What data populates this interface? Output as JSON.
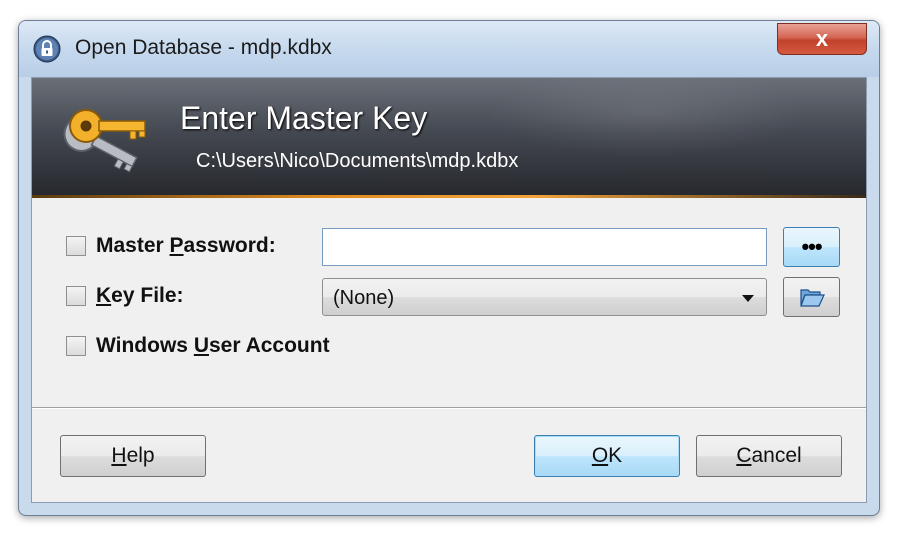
{
  "window": {
    "title": "Open Database - mdp.kdbx",
    "close_label": "x"
  },
  "banner": {
    "title": "Enter Master Key",
    "path": "C:\\Users\\Nico\\Documents\\mdp.kdbx"
  },
  "options": {
    "master_password": {
      "label_pre": "Master ",
      "label_access": "P",
      "label_post": "assword:",
      "checked": false,
      "value": "",
      "show_button": "•••"
    },
    "key_file": {
      "label_pre": "",
      "label_access": "K",
      "label_post": "ey File:",
      "checked": false,
      "selected": "(None)"
    },
    "windows_account": {
      "label_pre": "Windows ",
      "label_access": "U",
      "label_post": "ser Account",
      "checked": false
    }
  },
  "buttons": {
    "help_access": "H",
    "help_rest": "elp",
    "ok_access": "O",
    "ok_rest": "K",
    "cancel_access": "C",
    "cancel_rest": "ancel"
  },
  "colors": {
    "banner_accent": "#f2a23a",
    "close_red": "#c2412b",
    "default_button_blue": "#3c7fb1"
  },
  "icons": {
    "title": "lock-icon",
    "banner": "keys-icon",
    "browse": "folder-open-icon"
  }
}
